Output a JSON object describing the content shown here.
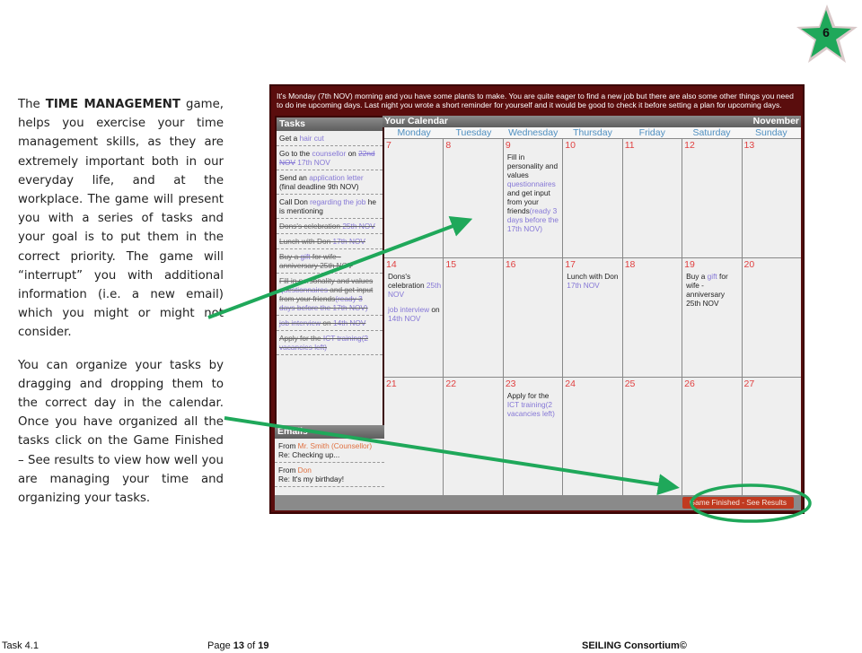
{
  "badge": {
    "page_number": "6",
    "color": "#1fa85a"
  },
  "left_text": {
    "p1_prefix": "The ",
    "p1_bold": "TIME MANAGEMENT",
    "p1_rest": " game, helps you exercise your time management skills, as they are extremely important both in our everyday life, and at the workplace. The game will present you with a series of tasks and your goal is to put them in the correct priority. The game will “interrupt” you with additional information (i.e. a new email) which you might or might not consider.",
    "p2": "You can organize your tasks by dragging and dropping them to the correct day in the calendar. Once you have organized all the tasks click on the Game Finished – See results to view how well you are managing your time and organizing your tasks."
  },
  "game": {
    "intro": "It's Monday (7th NOV) morning and you have some plants to make. You are quite eager to find a new job but there are also some other things you need to do ine upcoming days. Last night you wrote a short reminder for yourself and it would be good to check it before setting a plan for upcoming days.",
    "tasks_title": "Tasks",
    "tasks": [
      {
        "parts": [
          {
            "t": "Get a "
          },
          {
            "t": "hair cut",
            "link": true
          }
        ],
        "done": false
      },
      {
        "parts": [
          {
            "t": "Go to the "
          },
          {
            "t": "counsellor",
            "link": true
          },
          {
            "t": " on "
          },
          {
            "t": "22nd NOV",
            "link": true,
            "strike": true
          },
          {
            "t": " 17th NOV",
            "link": true
          }
        ],
        "done": false
      },
      {
        "parts": [
          {
            "t": "Send an "
          },
          {
            "t": "application letter",
            "link": true
          },
          {
            "t": " (final deadline 9th NOV)"
          }
        ],
        "done": false
      },
      {
        "parts": [
          {
            "t": "Call Don "
          },
          {
            "t": "regarding the job",
            "link": true
          },
          {
            "t": " he is mentioning"
          }
        ],
        "done": false
      },
      {
        "parts": [
          {
            "t": "Dons's celebration "
          },
          {
            "t": "25th NOV",
            "link": true
          }
        ],
        "done": true
      },
      {
        "parts": [
          {
            "t": "Lunch with Don "
          },
          {
            "t": "17th NOV",
            "link": true
          }
        ],
        "done": true
      },
      {
        "parts": [
          {
            "t": "Buy a "
          },
          {
            "t": "gift",
            "link": true
          },
          {
            "t": " for wife - anniversary 25th NOV"
          }
        ],
        "done": true
      },
      {
        "parts": [
          {
            "t": "Fill in personality and values "
          },
          {
            "t": "questionnaires",
            "link": true
          },
          {
            "t": " and get input from your friends"
          },
          {
            "t": "(ready 3 days before the 17th NOV)",
            "link": true
          }
        ],
        "done": true
      },
      {
        "parts": [
          {
            "t": "job interview",
            "link": true
          },
          {
            "t": " on "
          },
          {
            "t": "14th NOV",
            "link": true
          }
        ],
        "done": true
      },
      {
        "parts": [
          {
            "t": "Apply for the "
          },
          {
            "t": "ICT training(2 vacancies left)",
            "link": true
          }
        ],
        "done": true
      }
    ],
    "emails_title": "Emails",
    "emails": [
      {
        "from_label": "From ",
        "from_name": "Mr. Smith (Counsellor)",
        "subject": "Re: Checking up..."
      },
      {
        "from_label": "From ",
        "from_name": "Don",
        "subject": "Re: It's my birthday!"
      }
    ],
    "calendar_title": "Your Calendar",
    "month": "November",
    "day_names": [
      "Monday",
      "Tuesday",
      "Wednesday",
      "Thursday",
      "Friday",
      "Saturday",
      "Sunday"
    ],
    "weeks": [
      [
        {
          "date": "7",
          "entries": []
        },
        {
          "date": "8",
          "entries": []
        },
        {
          "date": "9",
          "entries": [
            [
              {
                "t": "Fill in personality and values "
              },
              {
                "t": "questionnaires",
                "link": true
              },
              {
                "t": " and get input from your friends"
              },
              {
                "t": "(ready 3 days before the 17th NOV)",
                "link": true
              }
            ]
          ]
        },
        {
          "date": "10",
          "entries": []
        },
        {
          "date": "11",
          "entries": []
        },
        {
          "date": "12",
          "entries": []
        },
        {
          "date": "13",
          "entries": []
        }
      ],
      [
        {
          "date": "14",
          "entries": [
            [
              {
                "t": "Dons's celebration "
              },
              {
                "t": "25th NOV",
                "link": true
              }
            ],
            [
              {
                "t": "job interview",
                "link": true
              },
              {
                "t": " on "
              },
              {
                "t": "14th NOV",
                "link": true
              }
            ]
          ]
        },
        {
          "date": "15",
          "entries": []
        },
        {
          "date": "16",
          "entries": []
        },
        {
          "date": "17",
          "entries": [
            [
              {
                "t": "Lunch with Don "
              },
              {
                "t": "17th NOV",
                "link": true
              }
            ]
          ]
        },
        {
          "date": "18",
          "entries": []
        },
        {
          "date": "19",
          "entries": [
            [
              {
                "t": "Buy a "
              },
              {
                "t": "gift",
                "link": true
              },
              {
                "t": " for wife - anniversary 25th NOV"
              }
            ]
          ]
        },
        {
          "date": "20",
          "entries": []
        }
      ],
      [
        {
          "date": "21",
          "entries": []
        },
        {
          "date": "22",
          "entries": []
        },
        {
          "date": "23",
          "entries": [
            [
              {
                "t": "Apply for the "
              },
              {
                "t": "ICT training(2 vacancies left)",
                "link": true
              }
            ]
          ]
        },
        {
          "date": "24",
          "entries": []
        },
        {
          "date": "25",
          "entries": []
        },
        {
          "date": "26",
          "entries": []
        },
        {
          "date": "27",
          "entries": []
        }
      ]
    ],
    "finish_button": "Game Finished - See Results",
    "colors": {
      "frame": "#5a0d0d",
      "link": "#8577d6",
      "date": "#e04040",
      "day_name": "#4f8fc0",
      "button": "#c03a20",
      "annotation": "#1fa85a"
    }
  },
  "footer": {
    "task": "Task 4.1",
    "page_prefix": "Page ",
    "page_current": "13",
    "page_of": " of ",
    "page_total": "19",
    "brand": "SEILING Consortium©"
  }
}
